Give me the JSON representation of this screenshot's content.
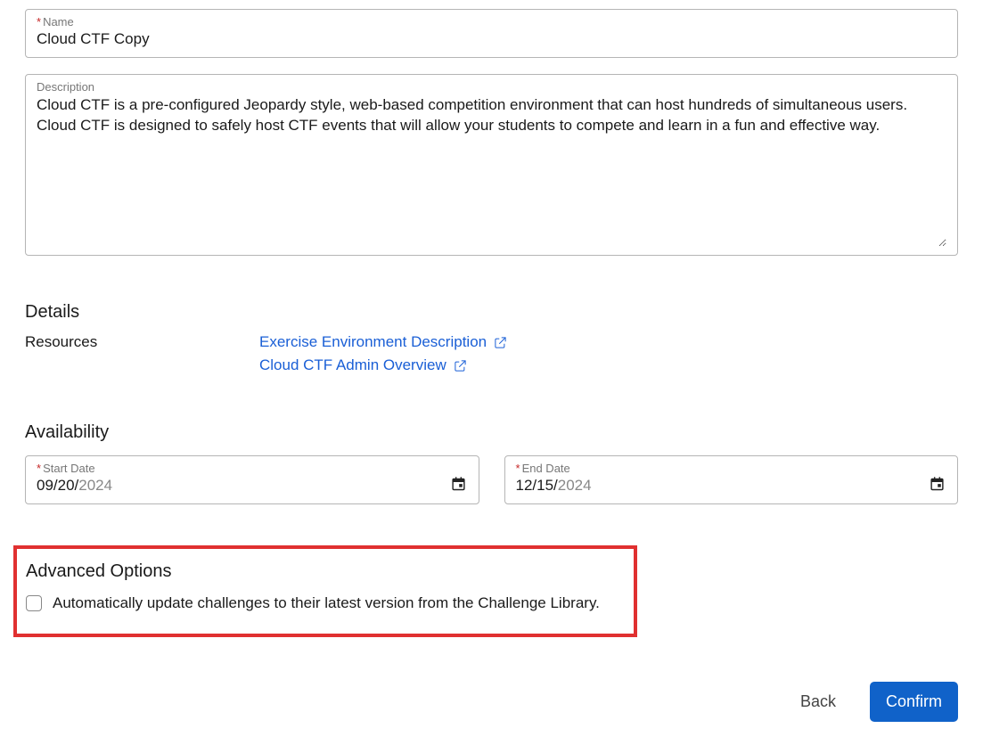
{
  "form": {
    "name_label": "Name",
    "name_value": "Cloud CTF Copy",
    "description_label": "Description",
    "description_value": "Cloud CTF is a pre-configured Jeopardy style, web-based competition environment that can host hundreds of simultaneous users. Cloud CTF is designed to safely host CTF events that will allow your students to compete and learn in a fun and effective way."
  },
  "details": {
    "heading": "Details",
    "resources_label": "Resources",
    "links": [
      {
        "label": "Exercise Environment Description"
      },
      {
        "label": "Cloud CTF Admin Overview"
      }
    ]
  },
  "availability": {
    "heading": "Availability",
    "start_label": "Start Date",
    "start_value_main": "09/20/",
    "start_value_year": "2024",
    "end_label": "End Date",
    "end_value_main": "12/15/",
    "end_value_year": "2024"
  },
  "advanced": {
    "heading": "Advanced Options",
    "auto_update_label": "Automatically update challenges to their latest version from the Challenge Library."
  },
  "actions": {
    "back": "Back",
    "confirm": "Confirm"
  }
}
